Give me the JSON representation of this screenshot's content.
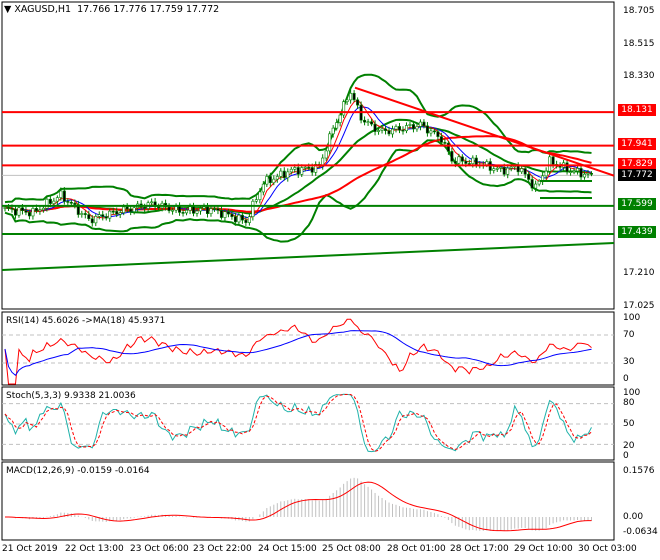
{
  "header": {
    "symbol": "XAGUSD,H1",
    "open": "17.766",
    "high": "17.776",
    "low": "17.759",
    "close": "17.772"
  },
  "price_axis": [
    "18.705",
    "18.515",
    "18.330",
    "17.210",
    "17.025"
  ],
  "levels": [
    {
      "label": "18.131",
      "value": 18.131,
      "color": "#ff0000"
    },
    {
      "label": "17.941",
      "value": 17.941,
      "color": "#ff0000"
    },
    {
      "label": "17.829",
      "value": 17.829,
      "color": "#ff0000"
    },
    {
      "label": "17.599",
      "value": 17.599,
      "color": "#008000"
    },
    {
      "label": "17.439",
      "value": 17.439,
      "color": "#008000"
    }
  ],
  "current_price": {
    "label": "17.772",
    "value": 17.772
  },
  "rsi": {
    "title": "RSI(14) 45.6026  ->MA(18) 45.9371",
    "axis": [
      "100",
      "70",
      "30",
      "0"
    ]
  },
  "stoch": {
    "title": "Stoch(5,3,3) 9.9338 21.0036",
    "axis": [
      "100",
      "80",
      "50",
      "20",
      "0"
    ]
  },
  "macd": {
    "title": "MACD(12,26,9) -0.0159 -0.0164",
    "axis": [
      "0.1576",
      "0.00",
      "-0.0634"
    ]
  },
  "time_axis": [
    "21 Oct 2019",
    "22 Oct 13:00",
    "23 Oct 06:00",
    "23 Oct 22:00",
    "24 Oct 15:00",
    "25 Oct 08:00",
    "28 Oct 01:00",
    "28 Oct 17:00",
    "29 Oct 10:00",
    "30 Oct 03:00"
  ],
  "chart_data": {
    "type": "candlestick",
    "price_path": [
      [
        0,
        17.58
      ],
      [
        8,
        17.56
      ],
      [
        16,
        17.66
      ],
      [
        24,
        17.52
      ],
      [
        33,
        17.57
      ],
      [
        42,
        17.61
      ],
      [
        50,
        17.57
      ],
      [
        59,
        17.58
      ],
      [
        69,
        17.51
      ],
      [
        74,
        17.73
      ],
      [
        82,
        17.8
      ],
      [
        90,
        17.82
      ],
      [
        94,
        18.04
      ],
      [
        99,
        18.25
      ],
      [
        102,
        18.1
      ],
      [
        105,
        18.05
      ],
      [
        108,
        18.02
      ],
      [
        114,
        18.04
      ],
      [
        119,
        18.06
      ],
      [
        125,
        17.98
      ],
      [
        128,
        17.86
      ],
      [
        136,
        17.84
      ],
      [
        142,
        17.8
      ],
      [
        147,
        17.82
      ],
      [
        152,
        17.7
      ],
      [
        156,
        17.85
      ],
      [
        162,
        17.8
      ],
      [
        168,
        17.77
      ]
    ],
    "ylim": [
      17.025,
      18.705
    ]
  },
  "colors": {
    "up": "#008000",
    "down": "#008000",
    "bands": "#008000",
    "ma_fast": "#ff0000",
    "ma_slow": "#0000ff",
    "rsi": "#ff0000",
    "rsi_ma": "#0000ff",
    "stoch_main": "#20b2aa",
    "stoch_signal": "#ff0000",
    "macd": "#c0c0c0",
    "signal": "#ff0000"
  }
}
